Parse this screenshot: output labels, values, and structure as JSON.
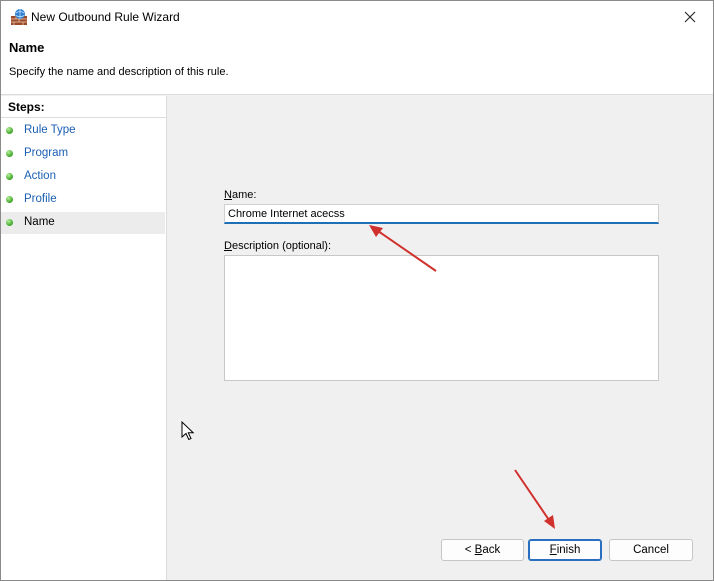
{
  "window": {
    "title": "New Outbound Rule Wizard"
  },
  "header": {
    "title": "Name",
    "description": "Specify the name and description of this rule."
  },
  "steps": {
    "label": "Steps:",
    "items": [
      {
        "label": "Rule Type"
      },
      {
        "label": "Program"
      },
      {
        "label": "Action"
      },
      {
        "label": "Profile"
      },
      {
        "label": "Name"
      }
    ],
    "active_index": 4
  },
  "form": {
    "name_label_accel": "N",
    "name_label_rest": "ame:",
    "name_value": "Chrome Internet acecss",
    "desc_label_accel": "D",
    "desc_label_rest": "escription (optional):",
    "desc_value": ""
  },
  "buttons": {
    "back_prefix": "< ",
    "back_accel": "B",
    "back_rest": "ack",
    "finish_accel": "F",
    "finish_rest": "inish",
    "cancel": "Cancel"
  },
  "colors": {
    "link": "#1a5fb4",
    "focus_border": "#1f6fb5",
    "annotation_arrow": "#d0312d",
    "step_dot": "#3ba326"
  },
  "icons": {
    "title": "firewall-icon",
    "close": "close-icon",
    "step": "green-dot-icon",
    "cursor": "mouse-pointer-icon"
  }
}
